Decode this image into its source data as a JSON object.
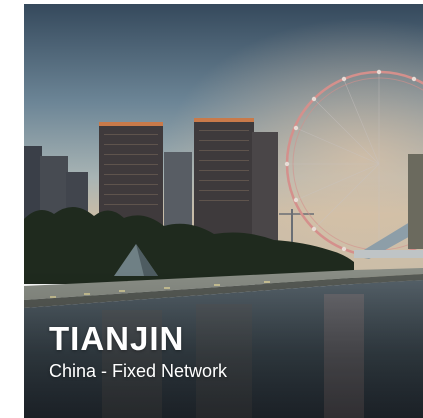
{
  "card": {
    "city": "TIANJIN",
    "subtitle": "China - Fixed Network"
  },
  "colors": {
    "sky_top": "#3d5468",
    "sky_mid": "#8fa6b0",
    "sky_glow": "#c9b9a3",
    "buildings": "#3b3f47",
    "trees": "#1f2b1d",
    "water": "#3e4d58",
    "wheel": "#d98f8c",
    "text": "#ffffff"
  }
}
